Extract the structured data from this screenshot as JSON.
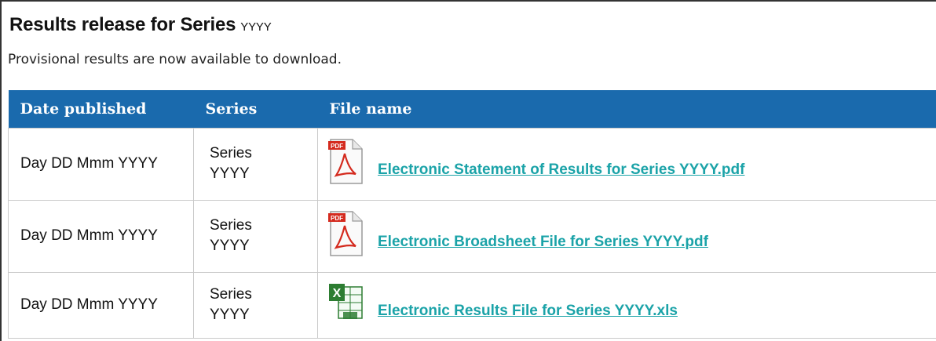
{
  "page": {
    "title": "Results release for Series",
    "title_year": "YYYY",
    "subtitle": "Provisional results are now available to download."
  },
  "table": {
    "headers": [
      "Date published",
      "Series",
      "File name"
    ],
    "rows": [
      {
        "date": "Day DD Mmm YYYY",
        "series_line1": "Series",
        "series_line2": "YYYY",
        "file_name": "Electronic Statement of Results for Series YYYY.pdf",
        "file_type": "pdf",
        "icon_label": "PDF",
        "icon": "pdf-file-icon"
      },
      {
        "date": "Day DD Mmm YYYY",
        "series_line1": "Series",
        "series_line2": "YYYY",
        "file_name": "Electronic Broadsheet File for Series YYYY.pdf",
        "file_type": "pdf",
        "icon_label": "PDF",
        "icon": "pdf-file-icon"
      },
      {
        "date": "Day DD Mmm YYYY",
        "series_line1": "Series",
        "series_line2": "YYYY",
        "file_name": "Electronic Results File for Series YYYY.xls",
        "file_type": "xls",
        "icon_label": "X",
        "icon": "excel-file-icon"
      }
    ]
  },
  "colors": {
    "header_bg": "#1a6aad",
    "link": "#1ba3a8",
    "pdf_red": "#d42a1e",
    "excel_green": "#2d7d32"
  }
}
